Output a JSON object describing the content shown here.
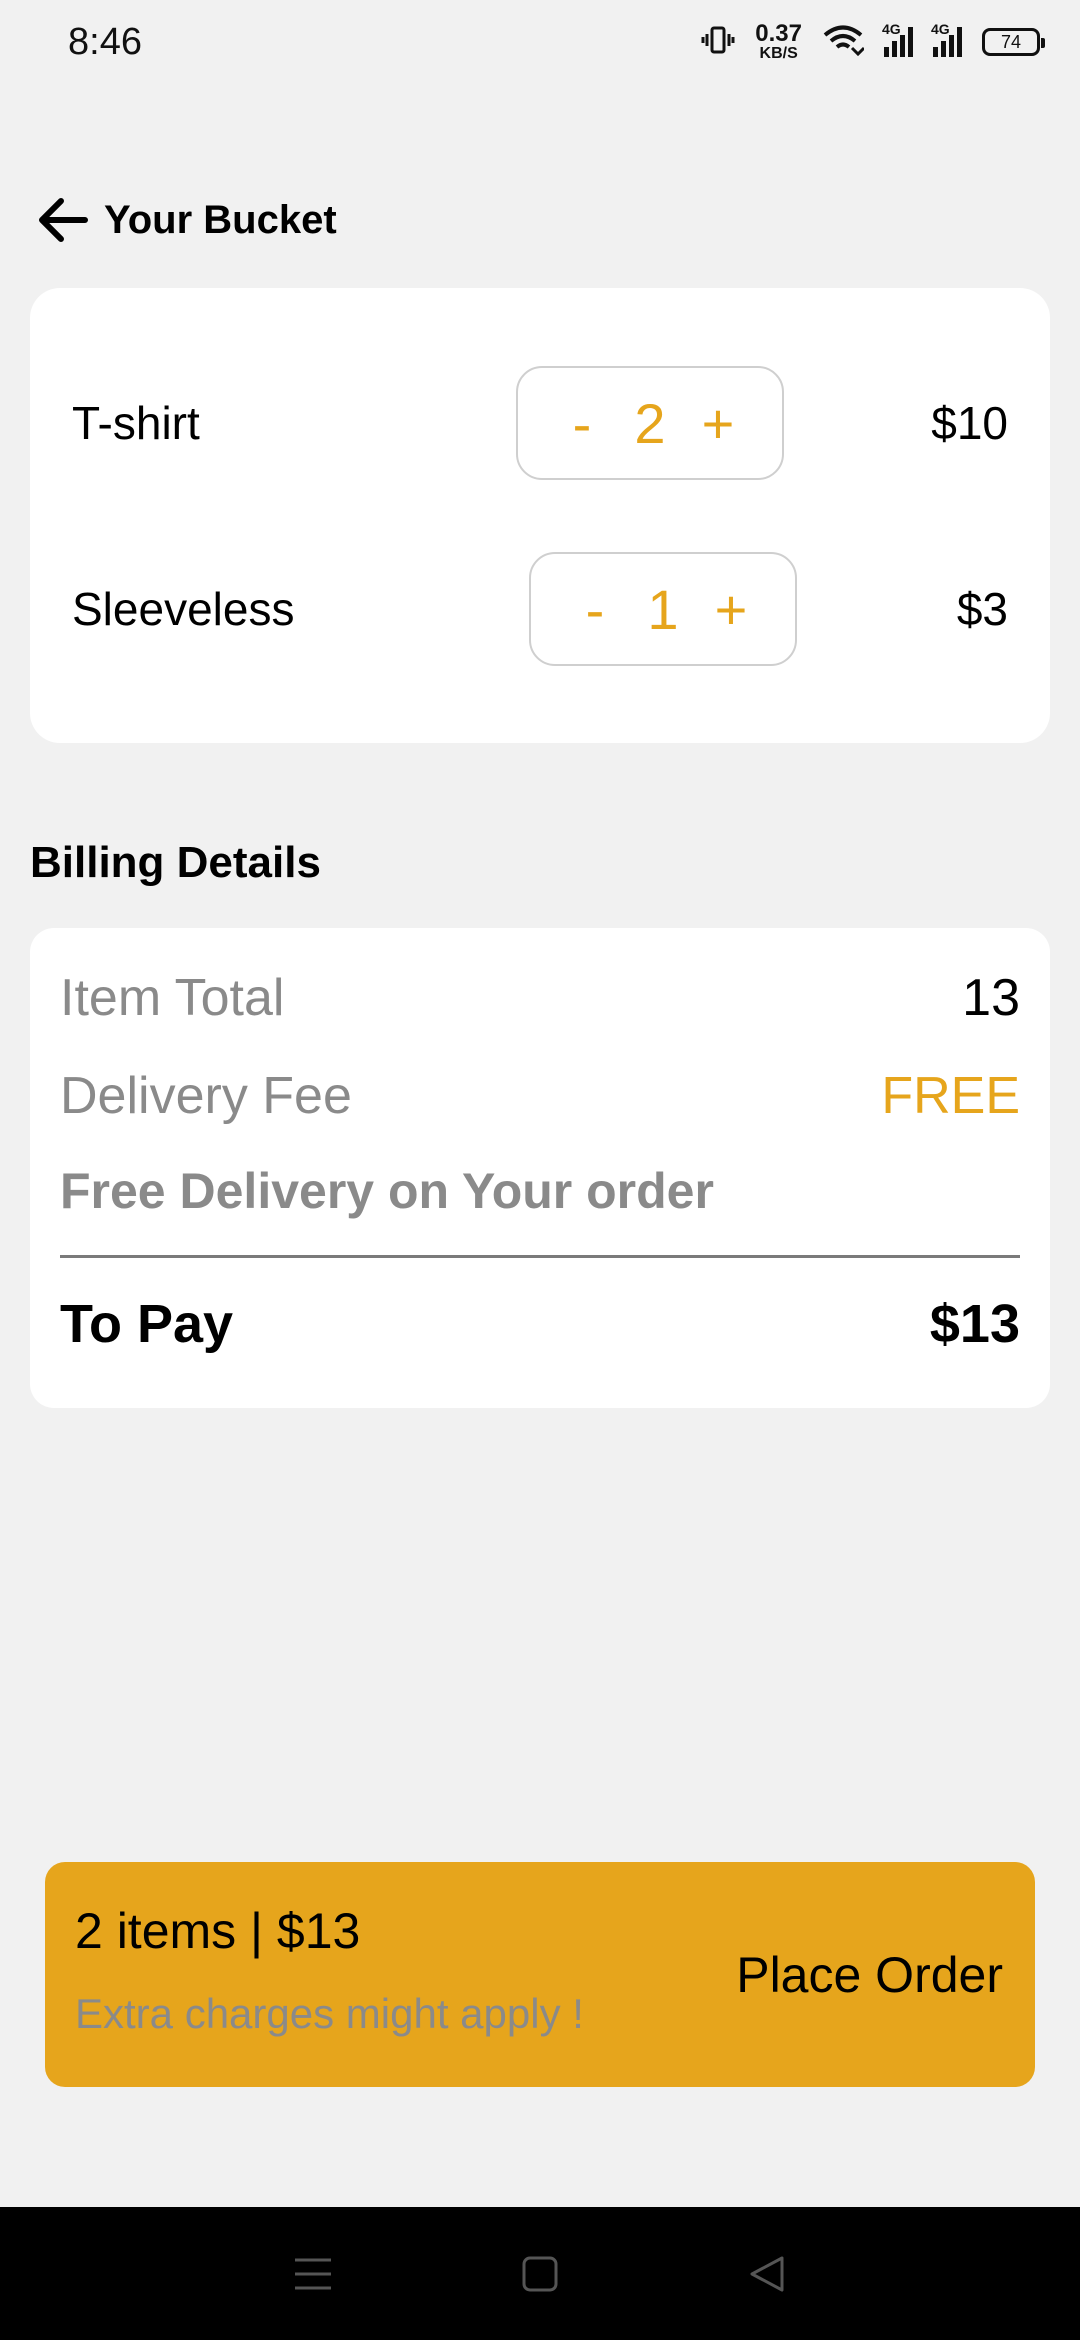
{
  "status_bar": {
    "time": "8:46",
    "net_speed_value": "0.37",
    "net_speed_unit": "KB/S",
    "sim1_label": "4G",
    "sim2_label": "4G",
    "battery": "74"
  },
  "header": {
    "title": "Your Bucket",
    "back_icon": "arrow-left-icon"
  },
  "cart": {
    "items": [
      {
        "name": "T-shirt",
        "minus": "-",
        "quantity": "2",
        "plus": "+",
        "price": "$10"
      },
      {
        "name": "Sleeveless",
        "minus": "-",
        "quantity": "1",
        "plus": "+",
        "price": "$3"
      }
    ]
  },
  "billing": {
    "heading": "Billing Details",
    "item_total_label": "Item Total",
    "item_total_value": "13",
    "delivery_fee_label": "Delivery Fee",
    "delivery_fee_value": "FREE",
    "free_delivery_note": "Free Delivery on Your order",
    "to_pay_label": "To Pay",
    "to_pay_value": "$13"
  },
  "order_bar": {
    "summary": "2 items | $13",
    "note": "Extra charges might apply !",
    "button_label": "Place Order"
  },
  "colors": {
    "accent": "#e6a51c",
    "background": "#f1f1f1",
    "card": "#ffffff",
    "muted_text": "#8a8a8a"
  },
  "nav_bar": {
    "icons": [
      "menu-icon",
      "home-square-icon",
      "back-triangle-icon"
    ]
  }
}
